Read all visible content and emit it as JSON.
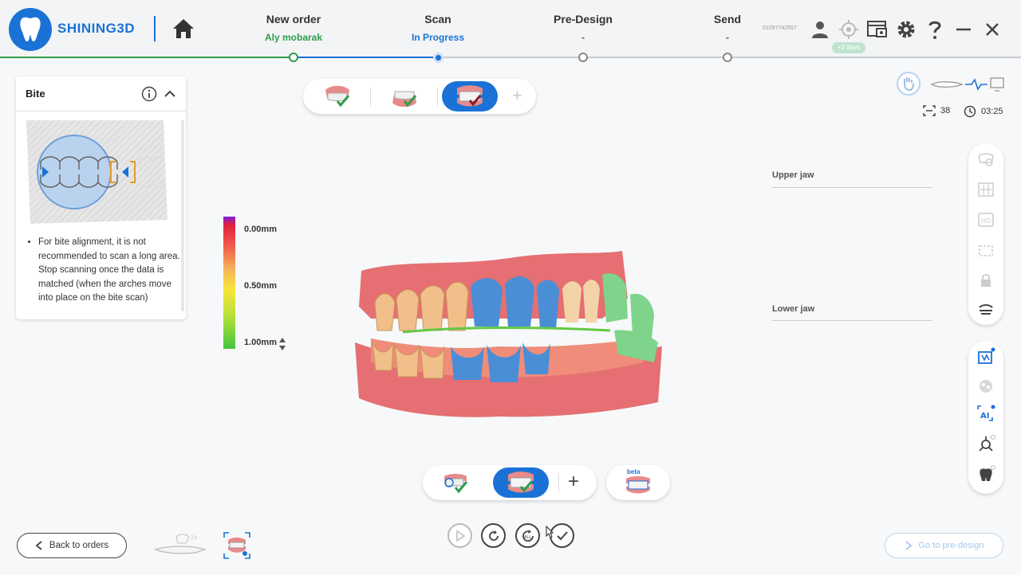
{
  "header": {
    "brand": "SHINING3D",
    "steps": [
      {
        "title": "New order",
        "sub": "Aly mobarak"
      },
      {
        "title": "Scan",
        "sub": "In Progress"
      },
      {
        "title": "Pre-Design",
        "sub": "-"
      },
      {
        "title": "Send",
        "sub": "-"
      }
    ],
    "serial": "01097742557",
    "days_badge": "+3 days",
    "icons": [
      "user-icon",
      "target-icon",
      "screenshot-icon",
      "gear-icon",
      "help-icon",
      "minimize-icon",
      "close-icon"
    ]
  },
  "bite_panel": {
    "title": "Bite",
    "instruction": "For bite alignment, it is not recommended to scan a long area. Stop scanning once the data is matched (when the arches move into place on the bite scan)"
  },
  "colorbar": {
    "labels": [
      "0.00mm",
      "0.50mm",
      "1.00mm"
    ]
  },
  "status": {
    "frame_count": "38",
    "timer": "03:25"
  },
  "jaws": {
    "upper": "Upper jaw",
    "lower": "Lower jaw"
  },
  "scan_toolbar": {
    "beta_label": "beta",
    "plus": "+"
  },
  "top_toolbar": {
    "plus": "+"
  },
  "footer": {
    "back_label": "Back to orders",
    "go_label": "Go to pre-design",
    "scanner_badge": "2x"
  },
  "colors": {
    "brand": "#1a72d6",
    "done": "#2e9e4b"
  }
}
